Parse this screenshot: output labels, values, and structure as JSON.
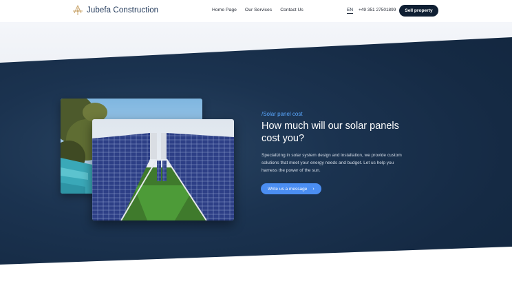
{
  "brand": {
    "name": "Jubefa Construction",
    "logo_icon": "compass-house-logo-icon"
  },
  "nav": {
    "items": [
      "Home Page",
      "Our Services",
      "Contact Us"
    ]
  },
  "header": {
    "lang": "EN",
    "phone": "+49 351 27501899",
    "cta_label": "Sell property"
  },
  "hero": {
    "eyebrow": "/Solar panel cost",
    "headline": "How much will our solar panels cost you?",
    "body": "Specializing in solar system design and installation, we provide custom solutions that meet your energy needs and budget. Let us help you harness the power of the sun.",
    "cta_label": "Write us a message",
    "cta_icon": "chevron-right-icon"
  },
  "colors": {
    "accent": "#4b8ef2",
    "dark": "#152a44",
    "eyebrow": "#5aa8ff"
  }
}
